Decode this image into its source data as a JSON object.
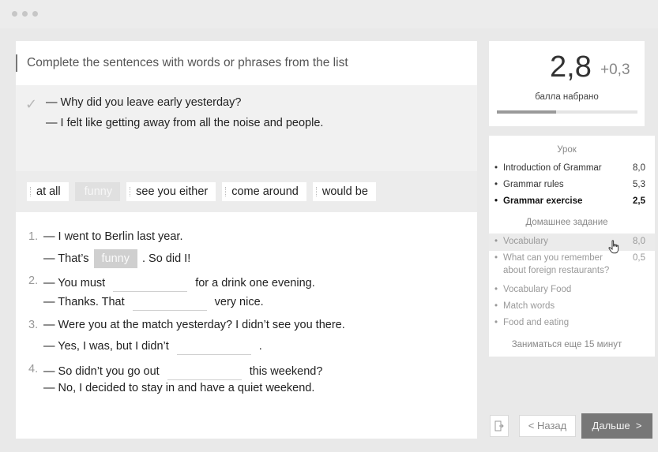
{
  "exercise": {
    "title": "Complete the sentences with words or phrases from the list",
    "example": {
      "line1": "— Why did you leave early yesterday?",
      "line2": "— I felt like getting away from all the noise and people."
    },
    "word_bank": [
      "at all",
      "funny",
      "see you either",
      "come around",
      "would be"
    ],
    "items": [
      {
        "num": "1.",
        "line1": "— I went to Berlin last year.",
        "line2_before": "— That’s",
        "line2_filled": "funny",
        "line2_after": ". So did I!"
      },
      {
        "num": "2.",
        "line1_before": "— You must",
        "line1_after": "for a drink one evening.",
        "line2_before": "— Thanks. That",
        "line2_after": "very nice."
      },
      {
        "num": "3.",
        "line1": "— Were you at the match yesterday? I didn’t see you there.",
        "line2_before": "— Yes, I was, but I didn’t",
        "line2_after": "."
      },
      {
        "num": "4.",
        "line1_before": "— So didn’t you go out",
        "line1_after": "this weekend?",
        "line2": "— No, I decided to stay in and have a quiet weekend."
      }
    ]
  },
  "score": {
    "value": "2,8",
    "delta": "+0,3",
    "label": "балла набрано",
    "progress": 0.42
  },
  "lesson": {
    "heading": "Урок",
    "items": [
      {
        "name": "Introduction of Grammar",
        "value": "8,0"
      },
      {
        "name": "Grammar rules",
        "value": "5,3"
      },
      {
        "name": "Grammar exercise",
        "value": "2,5"
      }
    ],
    "homework_heading": "Домашнее задание",
    "homework": [
      {
        "name": "Vocabulary",
        "value": "8,0"
      },
      {
        "name": "What can you remember",
        "name2": "about foreign restaurants?",
        "value": "0,5"
      },
      {
        "name": "Vocabulary Food",
        "value": ""
      },
      {
        "name": "Match words",
        "value": ""
      },
      {
        "name": "Food and eating",
        "value": ""
      }
    ],
    "extra": "Заниматься еще 15 минут"
  },
  "nav": {
    "back": "Назад",
    "next": "Дальше"
  },
  "colors": {
    "accent_button": "#777777",
    "used_chip": "#e0e0e0",
    "filled_answer": "#cfcfcf"
  }
}
